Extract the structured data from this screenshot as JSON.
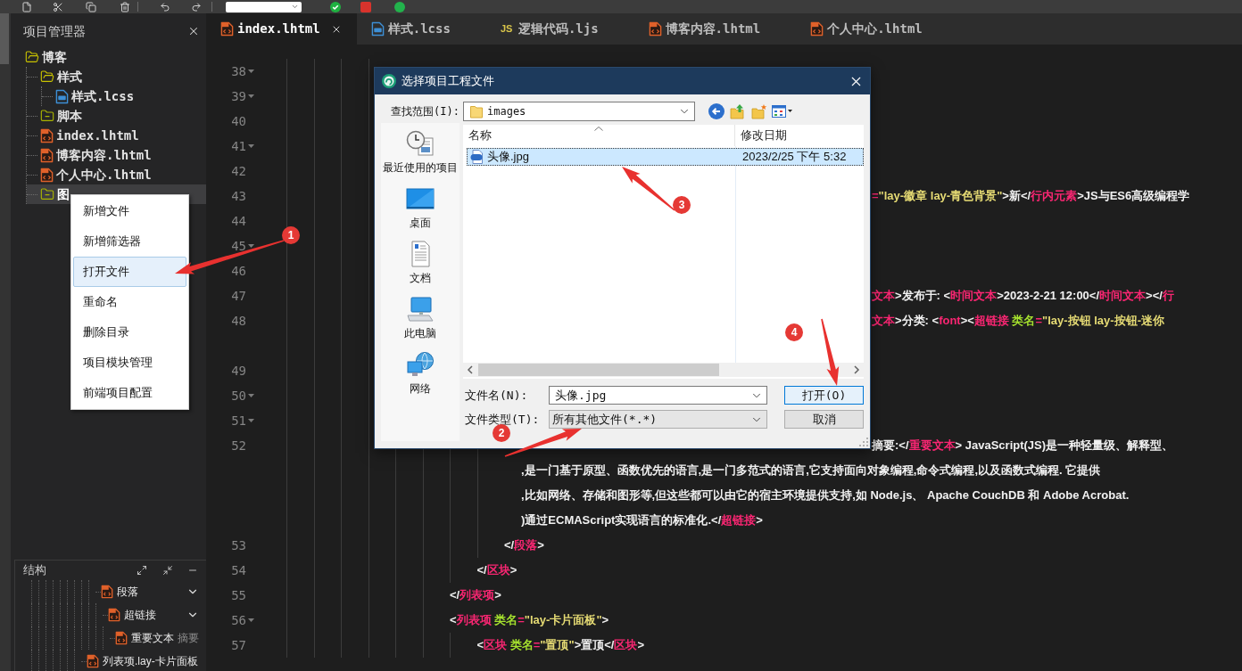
{
  "project_panel": {
    "title": "项目管理器",
    "tree": [
      {
        "label": "博客",
        "kind": "folder",
        "expanded": true,
        "selected": false,
        "children": [
          {
            "label": "样式",
            "kind": "folder",
            "expanded": true,
            "selected": false,
            "children": [
              {
                "label": "样式.lcss",
                "kind": "style_file",
                "selected": false
              }
            ]
          },
          {
            "label": "脚本",
            "kind": "folder",
            "expanded": false,
            "selected": false
          },
          {
            "label": "index.lhtml",
            "kind": "page_file",
            "selected": false
          },
          {
            "label": "博客内容.lhtml",
            "kind": "page_file",
            "selected": false
          },
          {
            "label": "个人中心.lhtml",
            "kind": "page_file",
            "selected": false
          },
          {
            "label": "图",
            "kind": "folder",
            "expanded": false,
            "selected": true
          }
        ]
      }
    ]
  },
  "context_menu": {
    "items": [
      {
        "label": "新增文件",
        "selected": false
      },
      {
        "label": "新增筛选器",
        "selected": false
      },
      {
        "label": "打开文件",
        "selected": true
      },
      {
        "label": "重命名",
        "selected": false
      },
      {
        "label": "删除目录",
        "selected": false
      },
      {
        "label": "项目模块管理",
        "selected": false
      },
      {
        "label": "前端项目配置",
        "selected": false
      }
    ]
  },
  "structure_panel": {
    "title": "结构",
    "items": [
      {
        "children": [
          {
            "children": [
              {
                "label": "段落",
                "expanded": true,
                "children": [
                  {
                    "label": "超链接",
                    "expanded": true,
                    "children": [
                      {
                        "label": "重要文本",
                        "note": "摘要"
                      }
                    ]
                  }
                ]
              }
            ]
          }
        ]
      },
      {
        "label": "列表项.lay-卡片面板"
      }
    ]
  },
  "editor": {
    "tabs": [
      {
        "label": "index.lhtml",
        "kind": "page",
        "selected": true
      },
      {
        "label": "样式.lcss",
        "kind": "style",
        "selected": false
      },
      {
        "label": "逻辑代码.ljs",
        "kind": "script",
        "icon_text": "JS",
        "selected": false
      },
      {
        "label": "博客内容.lhtml",
        "kind": "page",
        "selected": false
      },
      {
        "label": "个人中心.lhtml",
        "kind": "page",
        "selected": false
      }
    ],
    "rows": [
      {
        "kind": "line",
        "number": "38",
        "fold": true,
        "indent": "\t\t\t\t"
      },
      {
        "kind": "line",
        "number": "39",
        "fold": true,
        "indent": "\t\t\t\t"
      },
      {
        "kind": "line",
        "number": "40",
        "fold": false,
        "indent": "\t\t\t\t"
      },
      {
        "kind": "line",
        "number": "41",
        "fold": true,
        "indent": "\t\t\t\t"
      },
      {
        "kind": "line",
        "number": "42",
        "fold": false,
        "indent": "\t\t\t\t"
      },
      {
        "kind": "line",
        "number": "43",
        "fold": false,
        "indent": "\t\t\t\t",
        "tail_tokens": [
          {
            "kind": "operator",
            "text": "="
          },
          {
            "kind": "string",
            "text": "\"lay-徽章 lay-青色背景\""
          },
          {
            "kind": "plain",
            "text": ">新</"
          },
          {
            "kind": "tag",
            "text": "行内元素"
          },
          {
            "kind": "plain",
            "text": ">JS与ES6高级编程学"
          }
        ]
      },
      {
        "kind": "line",
        "number": "44",
        "fold": false,
        "indent": "\t\t\t\t"
      },
      {
        "kind": "line",
        "number": "45",
        "fold": true,
        "indent": "\t\t\t\t"
      },
      {
        "kind": "line",
        "number": "46",
        "fold": false,
        "indent": "\t\t\t\t"
      },
      {
        "kind": "line",
        "number": "47",
        "fold": false,
        "indent": "\t\t\t\t",
        "tail_tokens": [
          {
            "kind": "tag",
            "text": "文本"
          },
          {
            "kind": "plain",
            "text": ">发布于: <"
          },
          {
            "kind": "tag",
            "text": "时间文本"
          },
          {
            "kind": "plain",
            "text": ">2023-2-21 12:00</"
          },
          {
            "kind": "tag",
            "text": "时间文本"
          },
          {
            "kind": "plain",
            "text": "></"
          },
          {
            "kind": "tag",
            "text": "行"
          }
        ]
      },
      {
        "kind": "line",
        "number": "48",
        "fold": false,
        "indent": "\t\t\t\t",
        "tail_tokens": [
          {
            "kind": "tag",
            "text": "文本"
          },
          {
            "kind": "plain",
            "text": ">分类: <"
          },
          {
            "kind": "tag",
            "text": "font"
          },
          {
            "kind": "plain",
            "text": "><"
          },
          {
            "kind": "tag",
            "text": "超链接"
          },
          {
            "kind": "attr",
            "text": " 类名"
          },
          {
            "kind": "operator",
            "text": "="
          },
          {
            "kind": "string",
            "text": "\"lay-按钮 lay-按钮-迷你"
          }
        ]
      },
      {
        "kind": "wrap",
        "indent": "\t\t\t\t"
      },
      {
        "kind": "line",
        "number": "49",
        "fold": false,
        "indent": "\t\t\t\t"
      },
      {
        "kind": "line",
        "number": "50",
        "fold": true,
        "indent": "\t\t\t\t"
      },
      {
        "kind": "line",
        "number": "51",
        "fold": true,
        "indent": "\t\t\t\t"
      },
      {
        "kind": "line",
        "number": "52",
        "fold": false,
        "indent": "\t\t\t\t\t\t\t\t",
        "tail_tokens": [
          {
            "kind": "plain",
            "text": "摘要:</"
          },
          {
            "kind": "tag",
            "text": "重要文本"
          },
          {
            "kind": "plain",
            "text": "> JavaScript(JS)是一种轻量级、解释型、"
          }
        ]
      },
      {
        "kind": "wrap",
        "indent": "\t\t\t\t\t\t\t\t",
        "tokens": [
          {
            "kind": "plain",
            "text": ",是一门基于原型、函数优先的语言,是一门多范式的语言,它支持面向对象编程,命令式编程,以及函数式编程. 它提供"
          }
        ]
      },
      {
        "kind": "wrap",
        "indent": "\t\t\t\t\t\t\t\t",
        "tokens": [
          {
            "kind": "plain",
            "text": ",比如网络、存储和图形等,但这些都可以由它的宿主环境提供支持,如 Node.js、 Apache CouchDB 和 Adobe Acrobat."
          }
        ]
      },
      {
        "kind": "wrap",
        "indent": "\t\t\t\t\t\t\t\t",
        "tokens": [
          {
            "kind": "plain",
            "text": ")通过ECMAScript实现语言的标准化.</"
          },
          {
            "kind": "tag",
            "text": "超链接"
          },
          {
            "kind": "plain",
            "text": ">"
          }
        ]
      },
      {
        "kind": "line",
        "number": "53",
        "fold": false,
        "indent": "\t\t\t\t\t\t\t\t",
        "tokens": [
          {
            "kind": "plain",
            "text": "</"
          },
          {
            "kind": "tag",
            "text": "段落"
          },
          {
            "kind": "plain",
            "text": ">"
          }
        ]
      },
      {
        "kind": "line",
        "number": "54",
        "fold": false,
        "indent": "\t\t\t\t\t\t\t",
        "tokens": [
          {
            "kind": "plain",
            "text": "</"
          },
          {
            "kind": "tag",
            "text": "区块"
          },
          {
            "kind": "plain",
            "text": ">"
          }
        ]
      },
      {
        "kind": "line",
        "number": "55",
        "fold": false,
        "indent": "\t\t\t\t\t\t",
        "tokens": [
          {
            "kind": "plain",
            "text": "</"
          },
          {
            "kind": "tag",
            "text": "列表项"
          },
          {
            "kind": "plain",
            "text": ">"
          }
        ]
      },
      {
        "kind": "line",
        "number": "56",
        "fold": true,
        "indent": "\t\t\t\t\t\t",
        "tokens": [
          {
            "kind": "plain",
            "text": "<"
          },
          {
            "kind": "tag",
            "text": "列表项"
          },
          {
            "kind": "attr",
            "text": " 类名"
          },
          {
            "kind": "operator",
            "text": "="
          },
          {
            "kind": "string",
            "text": "\"lay-卡片面板\""
          },
          {
            "kind": "plain",
            "text": ">"
          }
        ]
      },
      {
        "kind": "line",
        "number": "57",
        "fold": false,
        "indent": "\t\t\t\t\t\t\t",
        "tokens": [
          {
            "kind": "plain",
            "text": "<"
          },
          {
            "kind": "tag",
            "text": "区块"
          },
          {
            "kind": "attr",
            "text": " 类名"
          },
          {
            "kind": "operator",
            "text": "="
          },
          {
            "kind": "string",
            "text": "\"置顶\""
          },
          {
            "kind": "plain",
            "text": ">置顶</"
          },
          {
            "kind": "tag",
            "text": "区块"
          },
          {
            "kind": "plain",
            "text": ">"
          }
        ]
      }
    ]
  },
  "dialog": {
    "title": "选择项目工程文件",
    "look_in": {
      "label": "查找范围(I):",
      "value": "images"
    },
    "places": [
      {
        "label": "最近使用的项目",
        "kind": "recent"
      },
      {
        "label": "桌面",
        "kind": "desktop"
      },
      {
        "label": "文档",
        "kind": "documents"
      },
      {
        "label": "此电脑",
        "kind": "computer"
      },
      {
        "label": "网络",
        "kind": "network"
      }
    ],
    "columns": [
      "名称",
      "修改日期"
    ],
    "files": [
      {
        "name": "头像.jpg",
        "modified": "2023/2/25 下午 5:32",
        "selected": true
      }
    ],
    "file_name": {
      "label": "文件名(N):",
      "value": "头像.jpg"
    },
    "file_type": {
      "label": "文件类型(T):",
      "value": "所有其他文件(*.*)"
    },
    "buttons": [
      {
        "label": "打开(O)",
        "default": true
      },
      {
        "label": "取消",
        "default": false
      }
    ]
  },
  "annotations": [
    {
      "number": "1"
    },
    {
      "number": "2"
    },
    {
      "number": "3"
    },
    {
      "number": "4"
    }
  ]
}
